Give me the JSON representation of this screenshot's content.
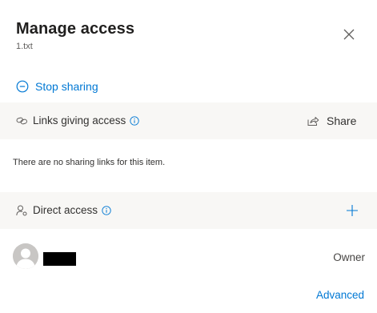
{
  "panel": {
    "title": "Manage access",
    "file_name": "1.txt",
    "close_icon": "close-icon"
  },
  "stop_sharing": {
    "label": "Stop sharing",
    "icon": "minus-circle-icon",
    "color": "#0078d4"
  },
  "links_section": {
    "title": "Links giving access",
    "icon": "link-icon",
    "info_icon": "info-icon",
    "share_label": "Share",
    "share_icon": "share-icon",
    "empty_message": "There are no sharing links for this item."
  },
  "direct_section": {
    "title": "Direct access",
    "icon": "person-key-icon",
    "info_icon": "info-icon",
    "add_icon": "add-icon",
    "people": [
      {
        "name": "",
        "name_redacted": true,
        "role": "Owner",
        "avatar_icon": "person-avatar-icon"
      }
    ]
  },
  "advanced_label": "Advanced",
  "colors": {
    "accent": "#0078d4",
    "section_bg": "#f8f7f5",
    "text": "#323130"
  }
}
